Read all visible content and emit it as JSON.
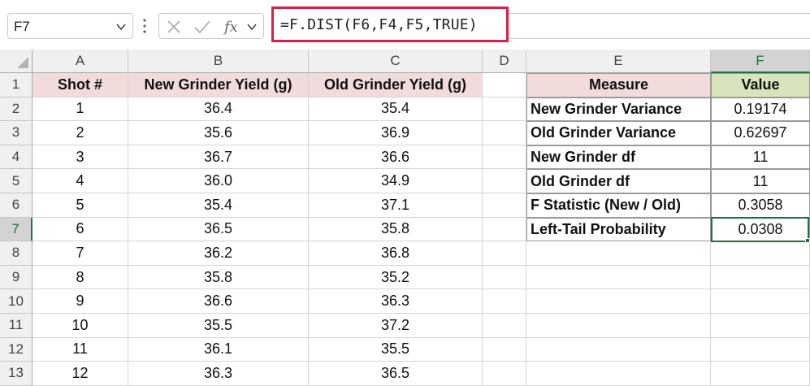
{
  "formula_bar": {
    "name_box": "F7",
    "formula": "=F.DIST(F6,F4,F5,TRUE)",
    "icons": [
      "chevron-down-icon",
      "vertical-dots-icon",
      "cancel-x-icon",
      "confirm-check-icon",
      "function-fx-icon",
      "chevron-down-icon"
    ]
  },
  "columns": [
    "A",
    "B",
    "C",
    "D",
    "E",
    "F"
  ],
  "rows": [
    "1",
    "2",
    "3",
    "4",
    "5",
    "6",
    "7",
    "8",
    "9",
    "10",
    "11",
    "12",
    "13"
  ],
  "data_table": {
    "headers": [
      "Shot #",
      "New Grinder Yield (g)",
      "Old Grinder Yield (g)"
    ],
    "rows": [
      [
        "1",
        "36.4",
        "35.4"
      ],
      [
        "2",
        "35.6",
        "36.9"
      ],
      [
        "3",
        "36.7",
        "36.6"
      ],
      [
        "4",
        "36.0",
        "34.9"
      ],
      [
        "5",
        "35.4",
        "37.1"
      ],
      [
        "6",
        "36.5",
        "35.8"
      ],
      [
        "7",
        "36.2",
        "36.8"
      ],
      [
        "8",
        "35.8",
        "35.2"
      ],
      [
        "9",
        "36.6",
        "36.3"
      ],
      [
        "10",
        "35.5",
        "37.2"
      ],
      [
        "11",
        "36.1",
        "35.5"
      ],
      [
        "12",
        "36.3",
        "36.5"
      ]
    ]
  },
  "stats_table": {
    "headers": [
      "Measure",
      "Value"
    ],
    "rows": [
      [
        "New Grinder Variance",
        "0.19174"
      ],
      [
        "Old Grinder Variance",
        "0.62697"
      ],
      [
        "New Grinder df",
        "11"
      ],
      [
        "Old Grinder df",
        "11"
      ],
      [
        "F Statistic (New / Old)",
        "0.3058"
      ],
      [
        "Left-Tail Probability",
        "0.0308"
      ]
    ]
  },
  "selection": {
    "active_cell": "F7",
    "selected_column": "F",
    "selected_row": "7"
  },
  "colors": {
    "accent_green": "#1e7145",
    "highlight_red": "#d6204b",
    "header_pink": "#f2dcdb",
    "header_green": "#d8e4bc"
  }
}
